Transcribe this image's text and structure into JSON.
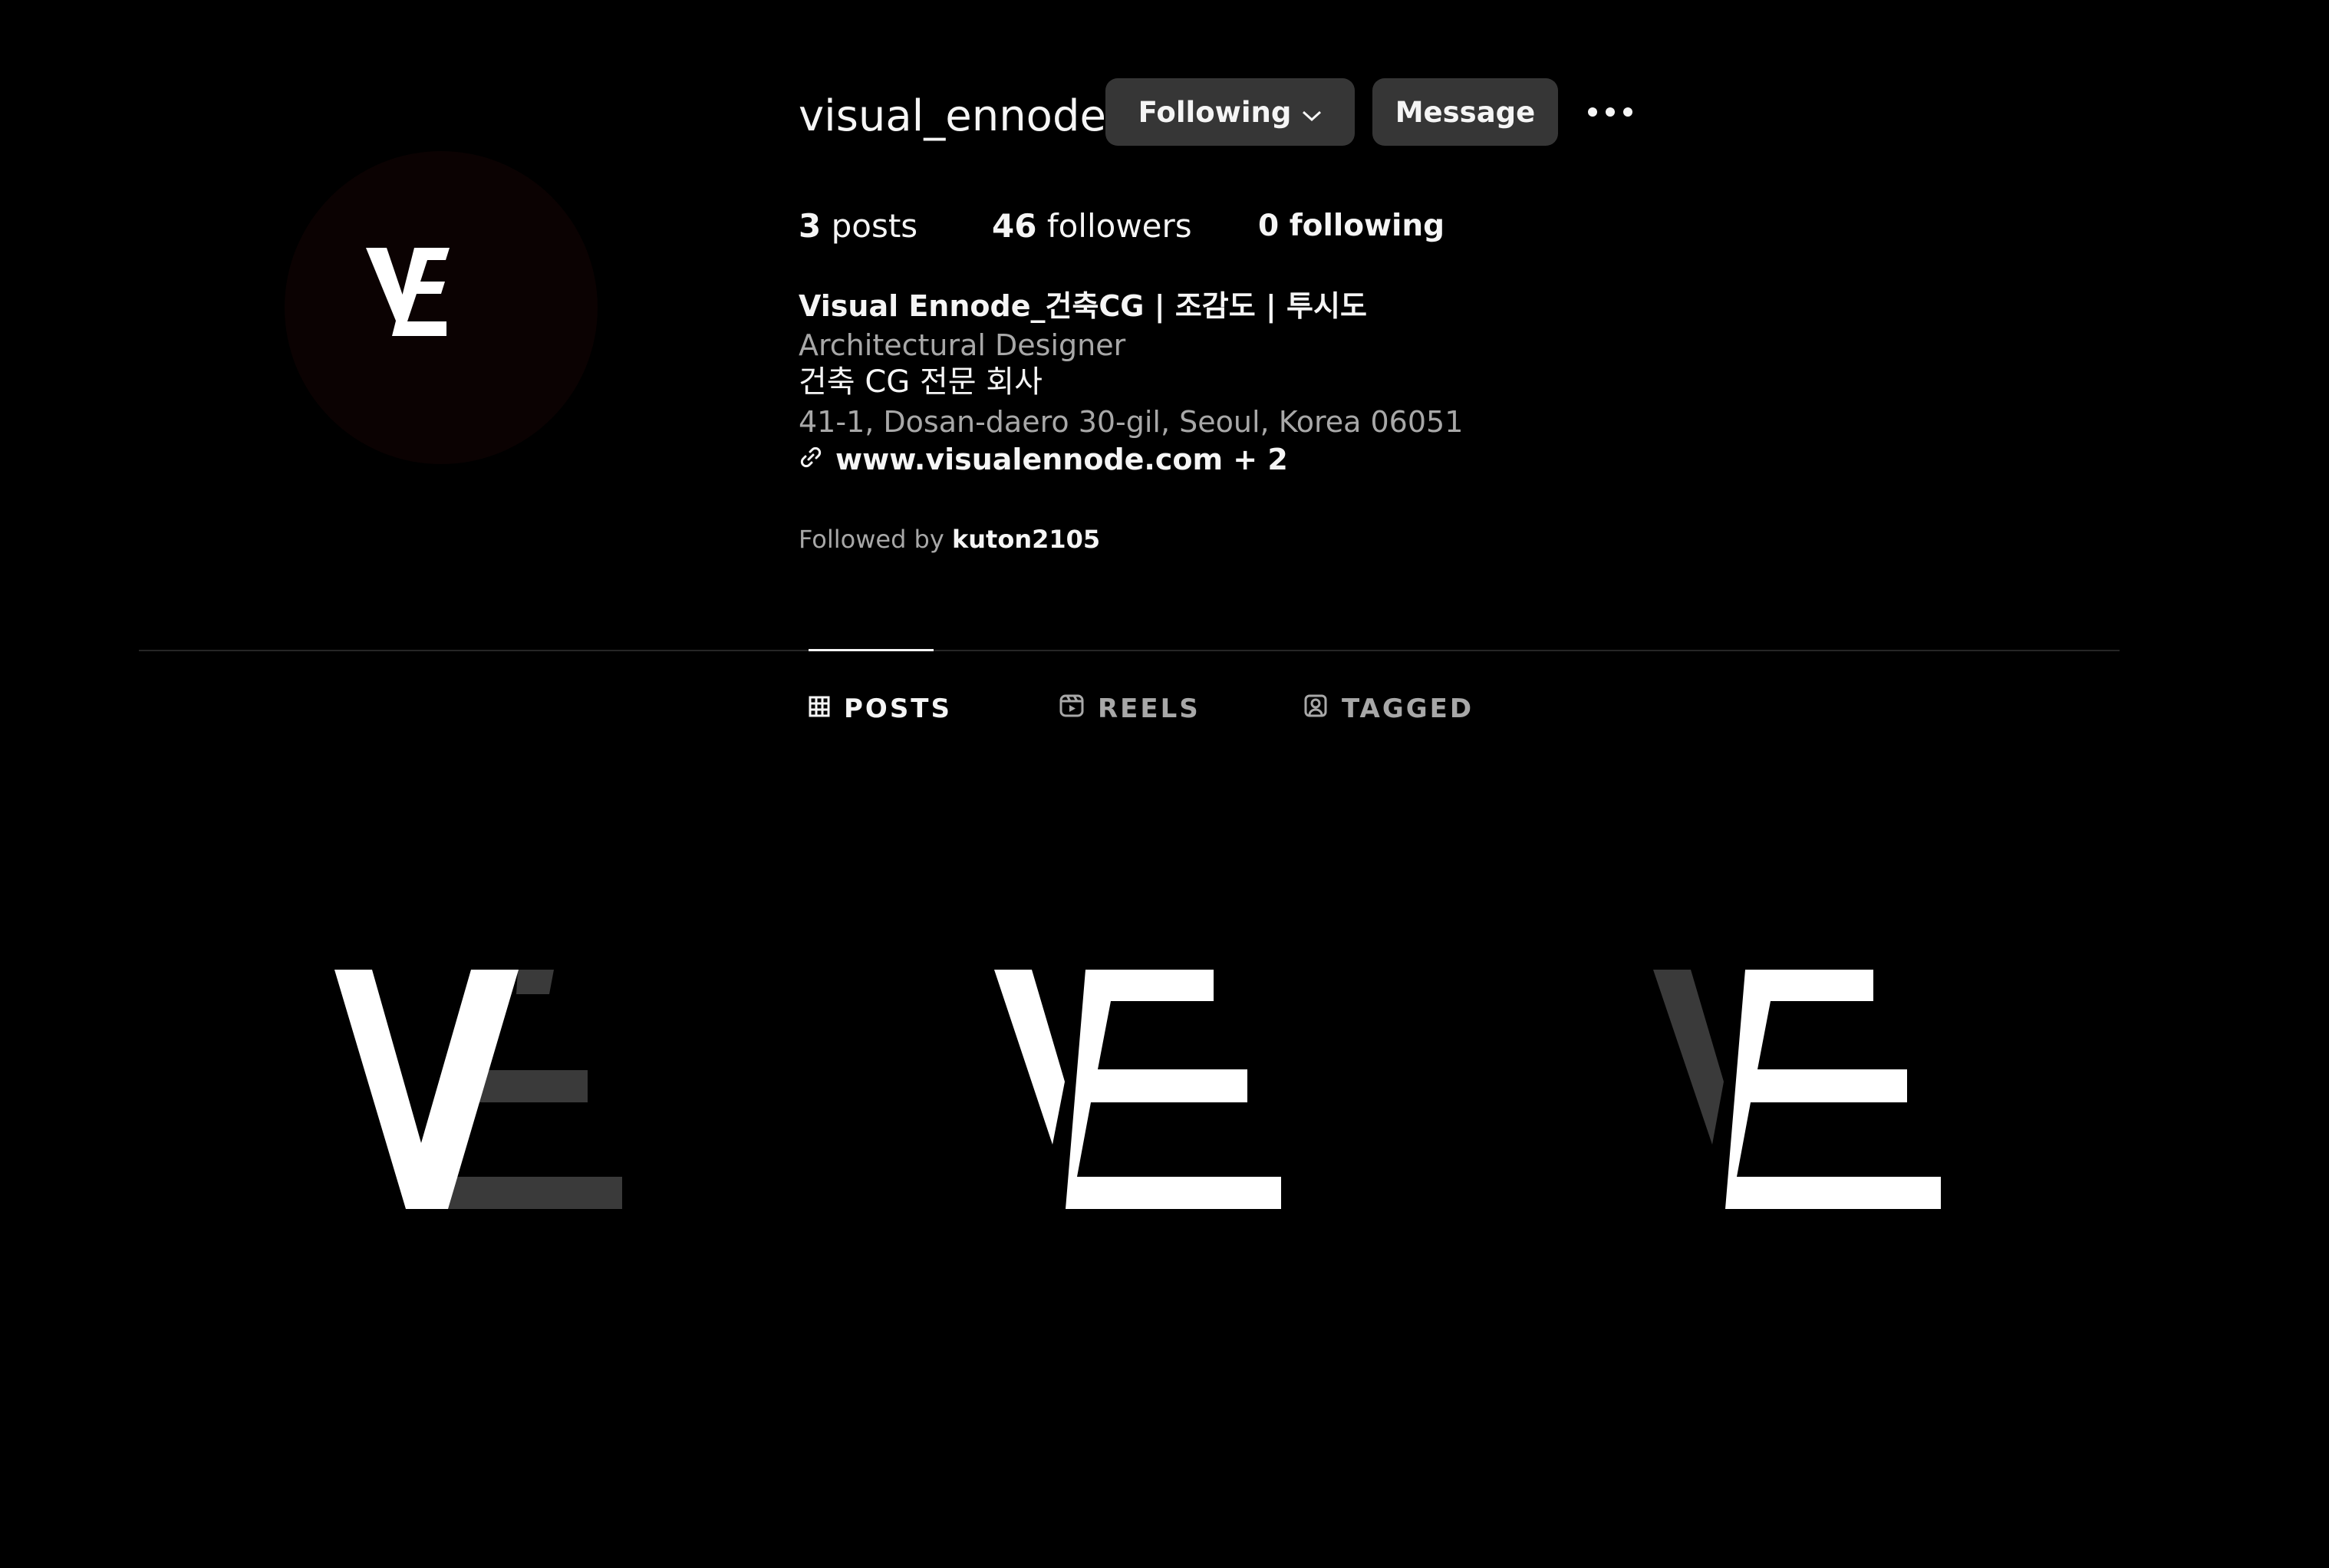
{
  "profile": {
    "username": "visual_ennode",
    "following_label": "Following",
    "message_label": "Message",
    "more_label": "More options"
  },
  "stats": {
    "posts_count": "3",
    "posts_label": "posts",
    "followers_count": "46",
    "followers_label": "followers",
    "following_text": "0 following"
  },
  "bio": {
    "name": "Visual Ennode_건축CG | 조감도 | 투시도",
    "category": "Architectural Designer",
    "description": "건축 CG 전문 회사",
    "address": "41-1, Dosan-daero 30-gil, Seoul, Korea 06051",
    "link": "www.visualennode.com + 2"
  },
  "followed_by": {
    "prefix": "Followed by",
    "user": "kuton2105"
  },
  "tabs": [
    {
      "label": "POSTS",
      "icon": "grid-icon",
      "active": true
    },
    {
      "label": "REELS",
      "icon": "reels-icon",
      "active": false
    },
    {
      "label": "TAGGED",
      "icon": "tagged-icon",
      "active": false
    }
  ],
  "colors": {
    "background": "#000000",
    "button": "#363636",
    "text": "#f5f5f5",
    "secondary_text": "#a8a8a8",
    "divider": "#262626",
    "logo_dim": "#3a3a3a"
  },
  "posts": [
    {
      "name": "post-ve-logo-e-dimmed",
      "alt": "VE logo with dimmed E"
    },
    {
      "name": "post-ve-logo-full",
      "alt": "VE logo"
    },
    {
      "name": "post-ve-logo-v-dimmed",
      "alt": "VE logo with dimmed V"
    }
  ]
}
